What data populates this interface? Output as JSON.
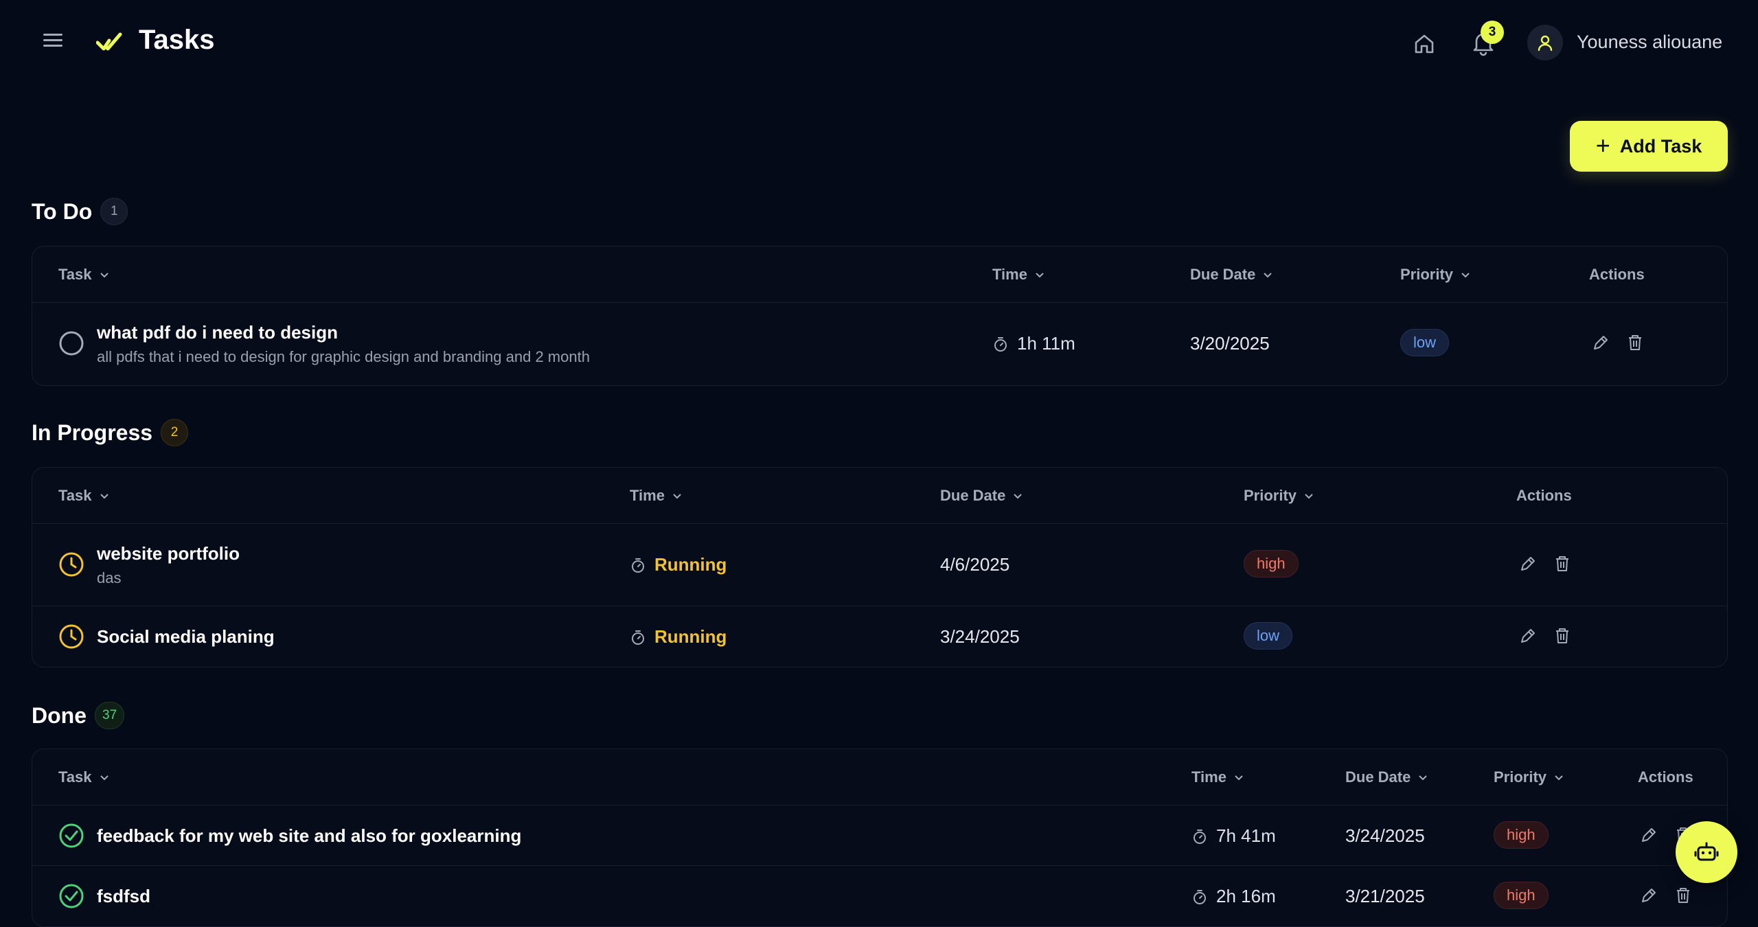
{
  "app": {
    "title": "Tasks"
  },
  "header": {
    "notifications_count": "3",
    "user_name": "Youness aliouane"
  },
  "toolbar": {
    "add_task_label": "Add Task"
  },
  "columns": {
    "task": "Task",
    "time": "Time",
    "due_date": "Due Date",
    "priority": "Priority",
    "actions": "Actions"
  },
  "sections": {
    "todo": {
      "title": "To Do",
      "count": "1",
      "rows": [
        {
          "name": "what pdf do i need to design",
          "desc": "all pdfs that i need to design for graphic design and branding and 2 month",
          "time": "1h 11m",
          "due": "3/20/2025",
          "priority": "low"
        }
      ]
    },
    "in_progress": {
      "title": "In Progress",
      "count": "2",
      "rows": [
        {
          "name": "website portfolio",
          "desc": "das",
          "time": "Running",
          "due": "4/6/2025",
          "priority": "high"
        },
        {
          "name": "Social media planing",
          "time": "Running",
          "due": "3/24/2025",
          "priority": "low"
        }
      ]
    },
    "done": {
      "title": "Done",
      "count": "37",
      "rows": [
        {
          "name": "feedback for my web site and also for goxlearning",
          "time": "7h 41m",
          "due": "3/24/2025",
          "priority": "high"
        },
        {
          "name": "fsdfsd",
          "time": "2h 16m",
          "due": "3/21/2025",
          "priority": "high"
        }
      ]
    }
  },
  "colors": {
    "accent": "#eefb57",
    "background": "#050a18",
    "running": "#f2c230",
    "done": "#4fd07a",
    "low": "#6ea2f6",
    "high": "#f07a6a"
  }
}
